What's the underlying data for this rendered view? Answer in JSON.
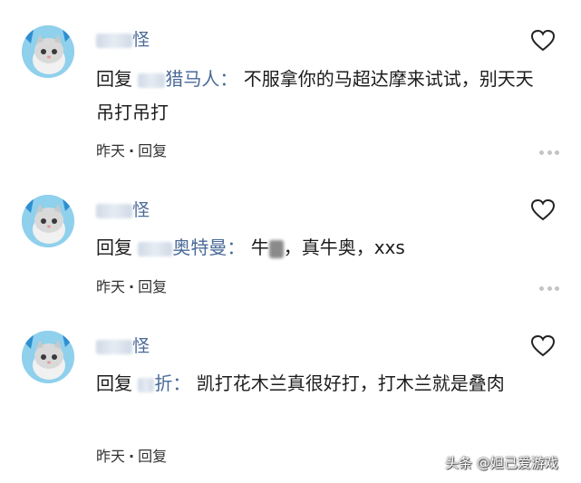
{
  "comments": [
    {
      "name_visible": "怪",
      "reply_word": "回复",
      "reply_target_visible": "猎马人",
      "colon": "：",
      "body": "不服拿你的马超达摩来试试，别天天吊打吊打",
      "time": "昨天",
      "reply_label": "回复"
    },
    {
      "name_visible": "怪",
      "reply_word": "回复",
      "reply_target_visible": "奥特曼",
      "colon": "：",
      "body_a": "牛",
      "body_b": "，真牛奥，xxs",
      "time": "昨天",
      "reply_label": "回复"
    },
    {
      "name_visible": "怪",
      "reply_word": "回复",
      "reply_target_visible": "折",
      "colon": "：",
      "body": "凯打花木兰真很好打，打木兰就是叠肉",
      "time": "昨天",
      "reply_label": "回复"
    }
  ],
  "meta_separator": "·",
  "watermark": "头条 @妲己爱游戏",
  "colors": {
    "link": "#4a6a97",
    "text": "#1c1c1c",
    "muted": "#c4c4c4"
  }
}
